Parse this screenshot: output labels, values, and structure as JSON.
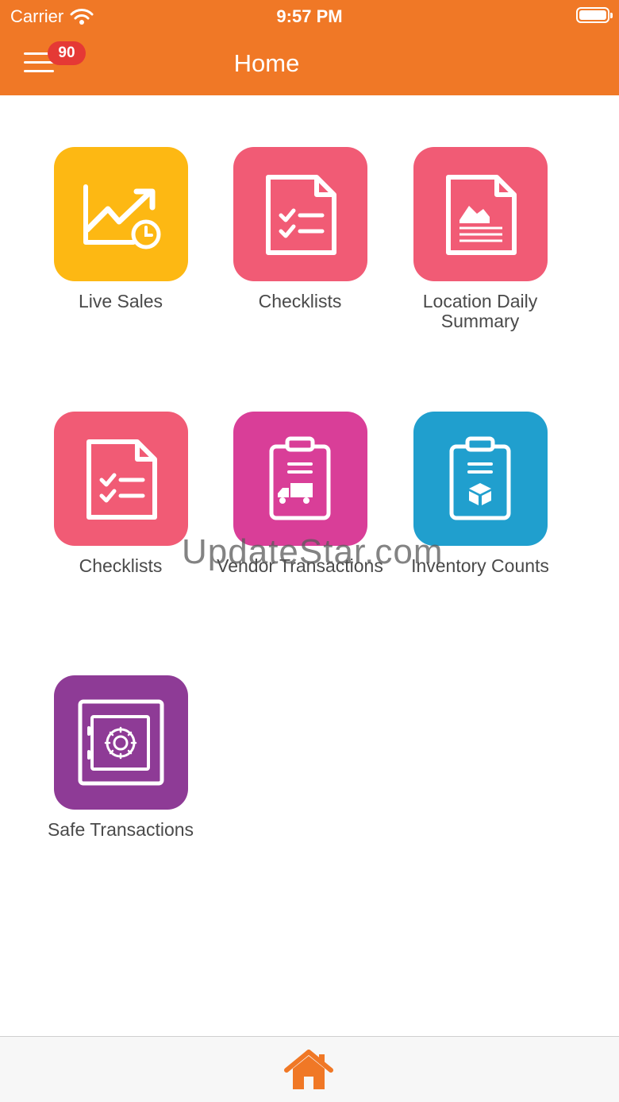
{
  "status_bar": {
    "carrier": "Carrier",
    "time": "9:57 PM"
  },
  "nav": {
    "title": "Home",
    "badge": "90"
  },
  "tiles": [
    {
      "label": "Live Sales",
      "color": "#FDB813",
      "icon": "line-chart-clock-icon"
    },
    {
      "label": "Checklists",
      "color": "#F15B75",
      "icon": "checklist-document-icon"
    },
    {
      "label": "Location Daily Summary",
      "color": "#F15B75",
      "icon": "report-chart-document-icon"
    },
    {
      "label": "Checklists",
      "color": "#F15B75",
      "icon": "checklist-document-icon"
    },
    {
      "label": "Vendor Transactions",
      "color": "#D93E98",
      "icon": "clipboard-truck-icon"
    },
    {
      "label": "Inventory Counts",
      "color": "#209FCE",
      "icon": "clipboard-box-icon"
    },
    {
      "label": "Safe Transactions",
      "color": "#8E3B96",
      "icon": "safe-icon"
    }
  ],
  "watermark": "UpdateStar.com",
  "colors": {
    "header": "#F07826",
    "home_icon": "#F07826"
  }
}
